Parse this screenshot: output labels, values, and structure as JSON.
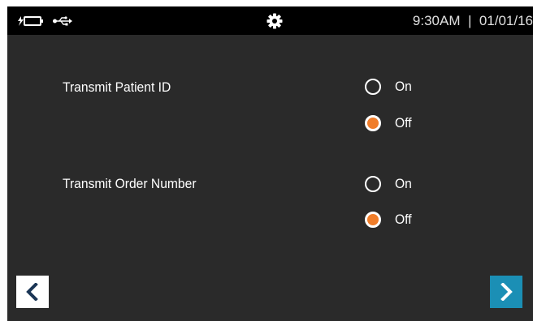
{
  "status_bar": {
    "battery_icon": "battery-charging-icon",
    "usb_icon": "usb-icon",
    "settings_icon": "gear-icon",
    "time": "9:30AM",
    "separator": "|",
    "date": "01/01/16"
  },
  "settings": [
    {
      "label": "Transmit Patient ID",
      "options": [
        {
          "label": "On",
          "selected": false
        },
        {
          "label": "Off",
          "selected": true
        }
      ]
    },
    {
      "label": "Transmit Order Number",
      "options": [
        {
          "label": "On",
          "selected": false
        },
        {
          "label": "Off",
          "selected": true
        }
      ]
    }
  ],
  "navigation": {
    "back_icon": "chevron-left-icon",
    "next_icon": "chevron-right-icon"
  },
  "colors": {
    "background": "#2a2a2a",
    "status_bar": "#000000",
    "selected_radio": "#f07d2a",
    "next_button": "#1b8fb5",
    "back_button": "#ffffff"
  }
}
